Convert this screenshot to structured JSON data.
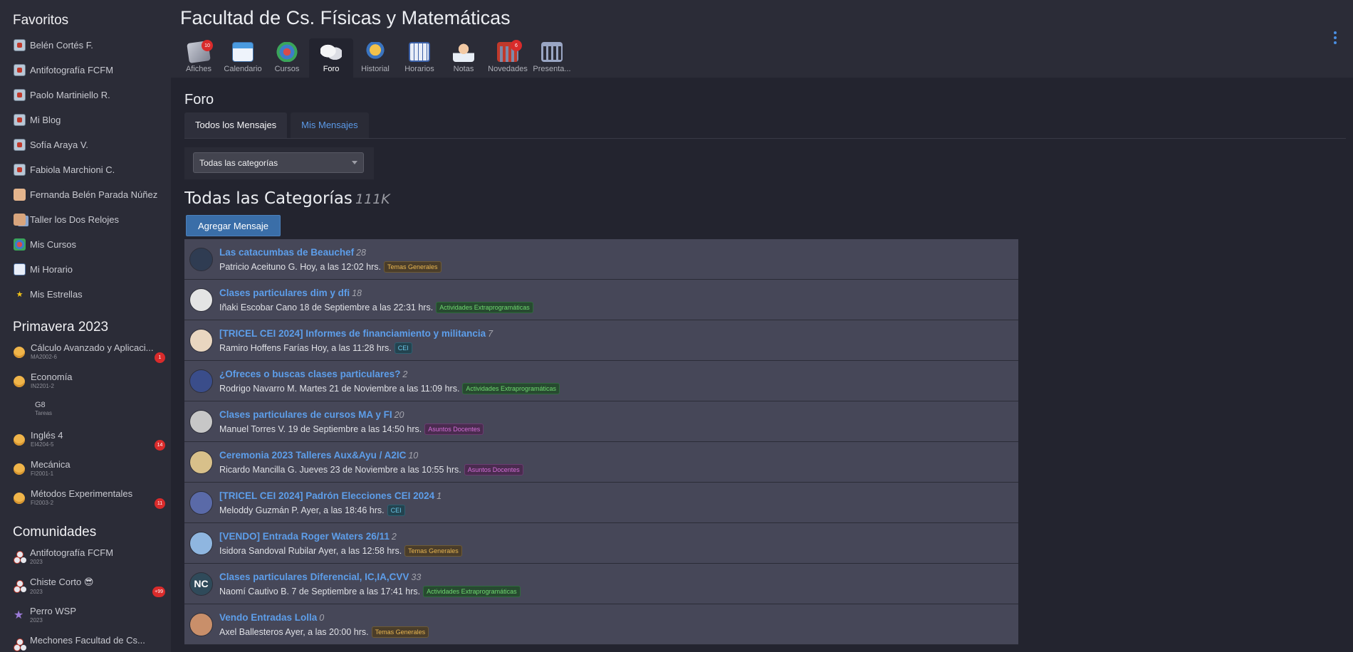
{
  "sidebar": {
    "favorites_title": "Favoritos",
    "favorites": [
      {
        "label": "Belén Cortés F.",
        "icon": "favorite-page-icon"
      },
      {
        "label": "Antifotografía FCFM",
        "icon": "favorite-page-icon"
      },
      {
        "label": "Paolo Martiniello R.",
        "icon": "favorite-page-icon"
      },
      {
        "label": "Mi Blog",
        "icon": "favorite-page-icon"
      },
      {
        "label": "Sofía Araya V.",
        "icon": "favorite-page-icon"
      },
      {
        "label": "Fabiola Marchioni C.",
        "icon": "favorite-page-icon"
      },
      {
        "label": "Fernanda Belén Parada Núñez",
        "icon": "person-icon"
      },
      {
        "label": "Taller los Dos Relojes",
        "icon": "group-icon"
      },
      {
        "label": "Mis Cursos",
        "icon": "courses-icon"
      },
      {
        "label": "Mi Horario",
        "icon": "schedule-icon"
      },
      {
        "label": "Mis Estrellas",
        "icon": "star-icon"
      }
    ],
    "semester_title": "Primavera 2023",
    "courses": [
      {
        "name": "Cálculo Avanzado y Aplicaci...",
        "code": "MA2002-6",
        "badge": "1",
        "dot": true
      },
      {
        "name": "Economía",
        "code": "IN2201-2",
        "badge": "",
        "dot": true
      },
      {
        "name": "G8",
        "code": "Tareas",
        "badge": "",
        "dot": false
      },
      {
        "name": "Inglés 4",
        "code": "EI4204-5",
        "badge": "14",
        "dot": true
      },
      {
        "name": "Mecánica",
        "code": "FI2001-1",
        "badge": "",
        "dot": true
      },
      {
        "name": "Métodos Experimentales",
        "code": "FI2003-2",
        "badge": "11",
        "dot": true
      }
    ],
    "communities_title": "Comunidades",
    "communities": [
      {
        "name": "Antifotografía FCFM",
        "year": "2023",
        "badge": "",
        "icon": "cluster"
      },
      {
        "name": "Chiste Corto 😎",
        "year": "2023",
        "badge": "+99",
        "icon": "cluster"
      },
      {
        "name": "Perro WSP",
        "year": "2023",
        "badge": "",
        "icon": "star"
      },
      {
        "name": "Mechones Facultad de Cs...",
        "year": "",
        "badge": "",
        "icon": "cluster"
      }
    ]
  },
  "header": {
    "title": "Facultad de Cs. Físicas y Matemáticas",
    "tools": [
      {
        "label": "Afiches",
        "icon": "afiches",
        "badge": "10",
        "active": false
      },
      {
        "label": "Calendario",
        "icon": "calendario",
        "badge": "",
        "active": false
      },
      {
        "label": "Cursos",
        "icon": "cursos",
        "badge": "",
        "active": false
      },
      {
        "label": "Foro",
        "icon": "foro",
        "badge": "",
        "active": true
      },
      {
        "label": "Historial",
        "icon": "historial",
        "badge": "",
        "active": false
      },
      {
        "label": "Horarios",
        "icon": "horarios",
        "badge": "",
        "active": false
      },
      {
        "label": "Notas",
        "icon": "notas",
        "badge": "",
        "active": false
      },
      {
        "label": "Novedades",
        "icon": "novedades",
        "badge": "6",
        "active": false
      },
      {
        "label": "Presenta...",
        "icon": "presenta",
        "badge": "",
        "active": false
      }
    ]
  },
  "forum": {
    "title": "Foro",
    "tabs": [
      {
        "label": "Todos los Mensajes",
        "active": true
      },
      {
        "label": "Mis Mensajes",
        "active": false
      }
    ],
    "category_select": "Todas las categorías",
    "heading": "Todas las Categorías",
    "count": "111K",
    "add_button": "Agregar Mensaje",
    "posts": [
      {
        "title": "Las catacumbas de Beauchef",
        "replies": "28",
        "author": "Patricio Aceituno G. Hoy, a las 12:02 hrs.",
        "tag": "Temas Generales",
        "tag_type": "general",
        "avatar": "#2f3c52",
        "initials": ""
      },
      {
        "title": "Clases particulares dim y dfi",
        "replies": "18",
        "author": "Iñaki Escobar Cano 18 de Septiembre a las 22:31 hrs.",
        "tag": "Actividades Extraprogramáticas",
        "tag_type": "extra",
        "avatar": "#e4e4e4",
        "initials": ""
      },
      {
        "title": "[TRICEL CEI 2024] Informes de financiamiento y militancia",
        "replies": "7",
        "author": "Ramiro Hoffens Farías Hoy, a las 11:28 hrs.",
        "tag": "CEI",
        "tag_type": "cei",
        "avatar": "#e9d6c0",
        "initials": ""
      },
      {
        "title": "¿Ofreces o buscas clases particulares?",
        "replies": "2",
        "author": "Rodrigo Navarro M. Martes 21 de Noviembre a las 11:09 hrs.",
        "tag": "Actividades Extraprogramáticas",
        "tag_type": "extra",
        "avatar": "#3a4d8a",
        "initials": ""
      },
      {
        "title": "Clases particulares de cursos MA y FI",
        "replies": "20",
        "author": "Manuel Torres V. 19 de Septiembre a las 14:50 hrs.",
        "tag": "Asuntos Docentes",
        "tag_type": "docentes",
        "avatar": "#c7c7c7",
        "initials": ""
      },
      {
        "title": "Ceremonia 2023 Talleres Aux&Ayu / A2IC",
        "replies": "10",
        "author": "Ricardo Mancilla G. Jueves 23 de Noviembre a las 10:55 hrs.",
        "tag": "Asuntos Docentes",
        "tag_type": "docentes",
        "avatar": "#d8c08a",
        "initials": ""
      },
      {
        "title": "[TRICEL CEI 2024] Padrón Elecciones CEI 2024",
        "replies": "1",
        "author": "Meloddy Guzmán P. Ayer, a las 18:46 hrs.",
        "tag": "CEI",
        "tag_type": "cei",
        "avatar": "#5a6aa8",
        "initials": ""
      },
      {
        "title": "[VENDO] Entrada Roger Waters 26/11",
        "replies": "2",
        "author": "Isidora Sandoval Rubilar Ayer, a las 12:58 hrs.",
        "tag": "Temas Generales",
        "tag_type": "general",
        "avatar": "#8fb6e0",
        "initials": ""
      },
      {
        "title": "Clases particulares Diferencial, IC,IA,CVV",
        "replies": "33",
        "author": "Naomí Cautivo B. 7 de Septiembre a las 17:41 hrs.",
        "tag": "Actividades Extraprogramáticas",
        "tag_type": "extra",
        "avatar": "#2f4a5a",
        "initials": "NC"
      },
      {
        "title": "Vendo Entradas Lolla",
        "replies": "0",
        "author": "Axel Ballesteros Ayer, a las 20:00 hrs.",
        "tag": "Temas Generales",
        "tag_type": "general",
        "avatar": "#c98f6a",
        "initials": ""
      }
    ]
  }
}
